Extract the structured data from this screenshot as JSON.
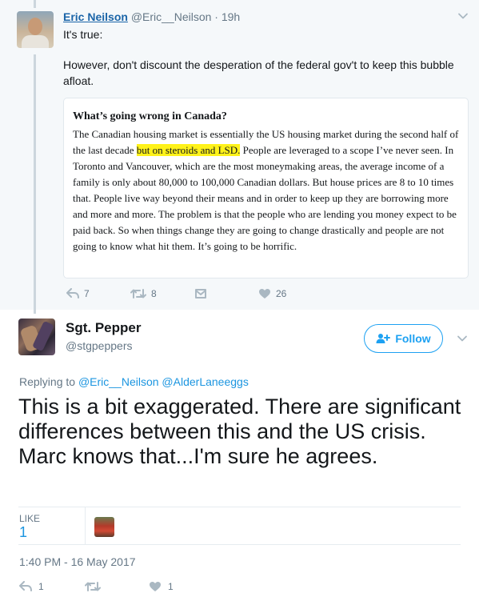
{
  "parent_tweet": {
    "name": "Eric Neilson",
    "handle": "@Eric__Neilson",
    "time": "19h",
    "separator": "·",
    "text_line1": "It's true:",
    "text_line2": "However, don't discount the desperation of the federal gov't to keep this bubble afloat.",
    "quote": {
      "title": "What’s going wrong in Canada?",
      "body_before": "The Canadian housing market is essentially the US housing market during the second half of the last decade ",
      "body_highlight": "but on steroids and LSD.",
      "body_after": " People are leveraged to a scope I’ve never seen. In Toronto and Vancouver, which are the most moneymaking areas, the average income of a family is only about  80,000 to 100,000 Canadian dollars. But house prices are 8 to 10 times that. People live way beyond their means and in order to keep up they are borrowing more and more and more. The problem is that the people who are lending you money expect to be paid back. So when things change they are going to change drastically and people are not going to know what hit them. It’s going to be horrific."
    },
    "actions": {
      "reply_count": "7",
      "retweet_count": "8",
      "like_count": "26"
    }
  },
  "main_tweet": {
    "name": "Sgt. Pepper",
    "handle": "@stgpeppers",
    "follow_label": "Follow",
    "replying_prefix": "Replying to",
    "mention1": "@Eric__Neilson",
    "mention2": "@AlderLaneeggs",
    "text": "This is a bit exaggerated.  There are significant differences between this and the US crisis.  Marc knows that...I'm sure he agrees.",
    "likes_label": "LIKE",
    "likes_count": "1",
    "timestamp": "1:40 PM - 16 May 2017",
    "actions": {
      "reply_count": "1",
      "retweet_count": "",
      "like_count": "1"
    }
  },
  "colors": {
    "link_blue": "#1b95e0",
    "follow_blue": "#1da1f2",
    "muted_gray": "#657786",
    "highlight_yellow": "#fff21a",
    "parent_bg": "#f5f8fa"
  }
}
